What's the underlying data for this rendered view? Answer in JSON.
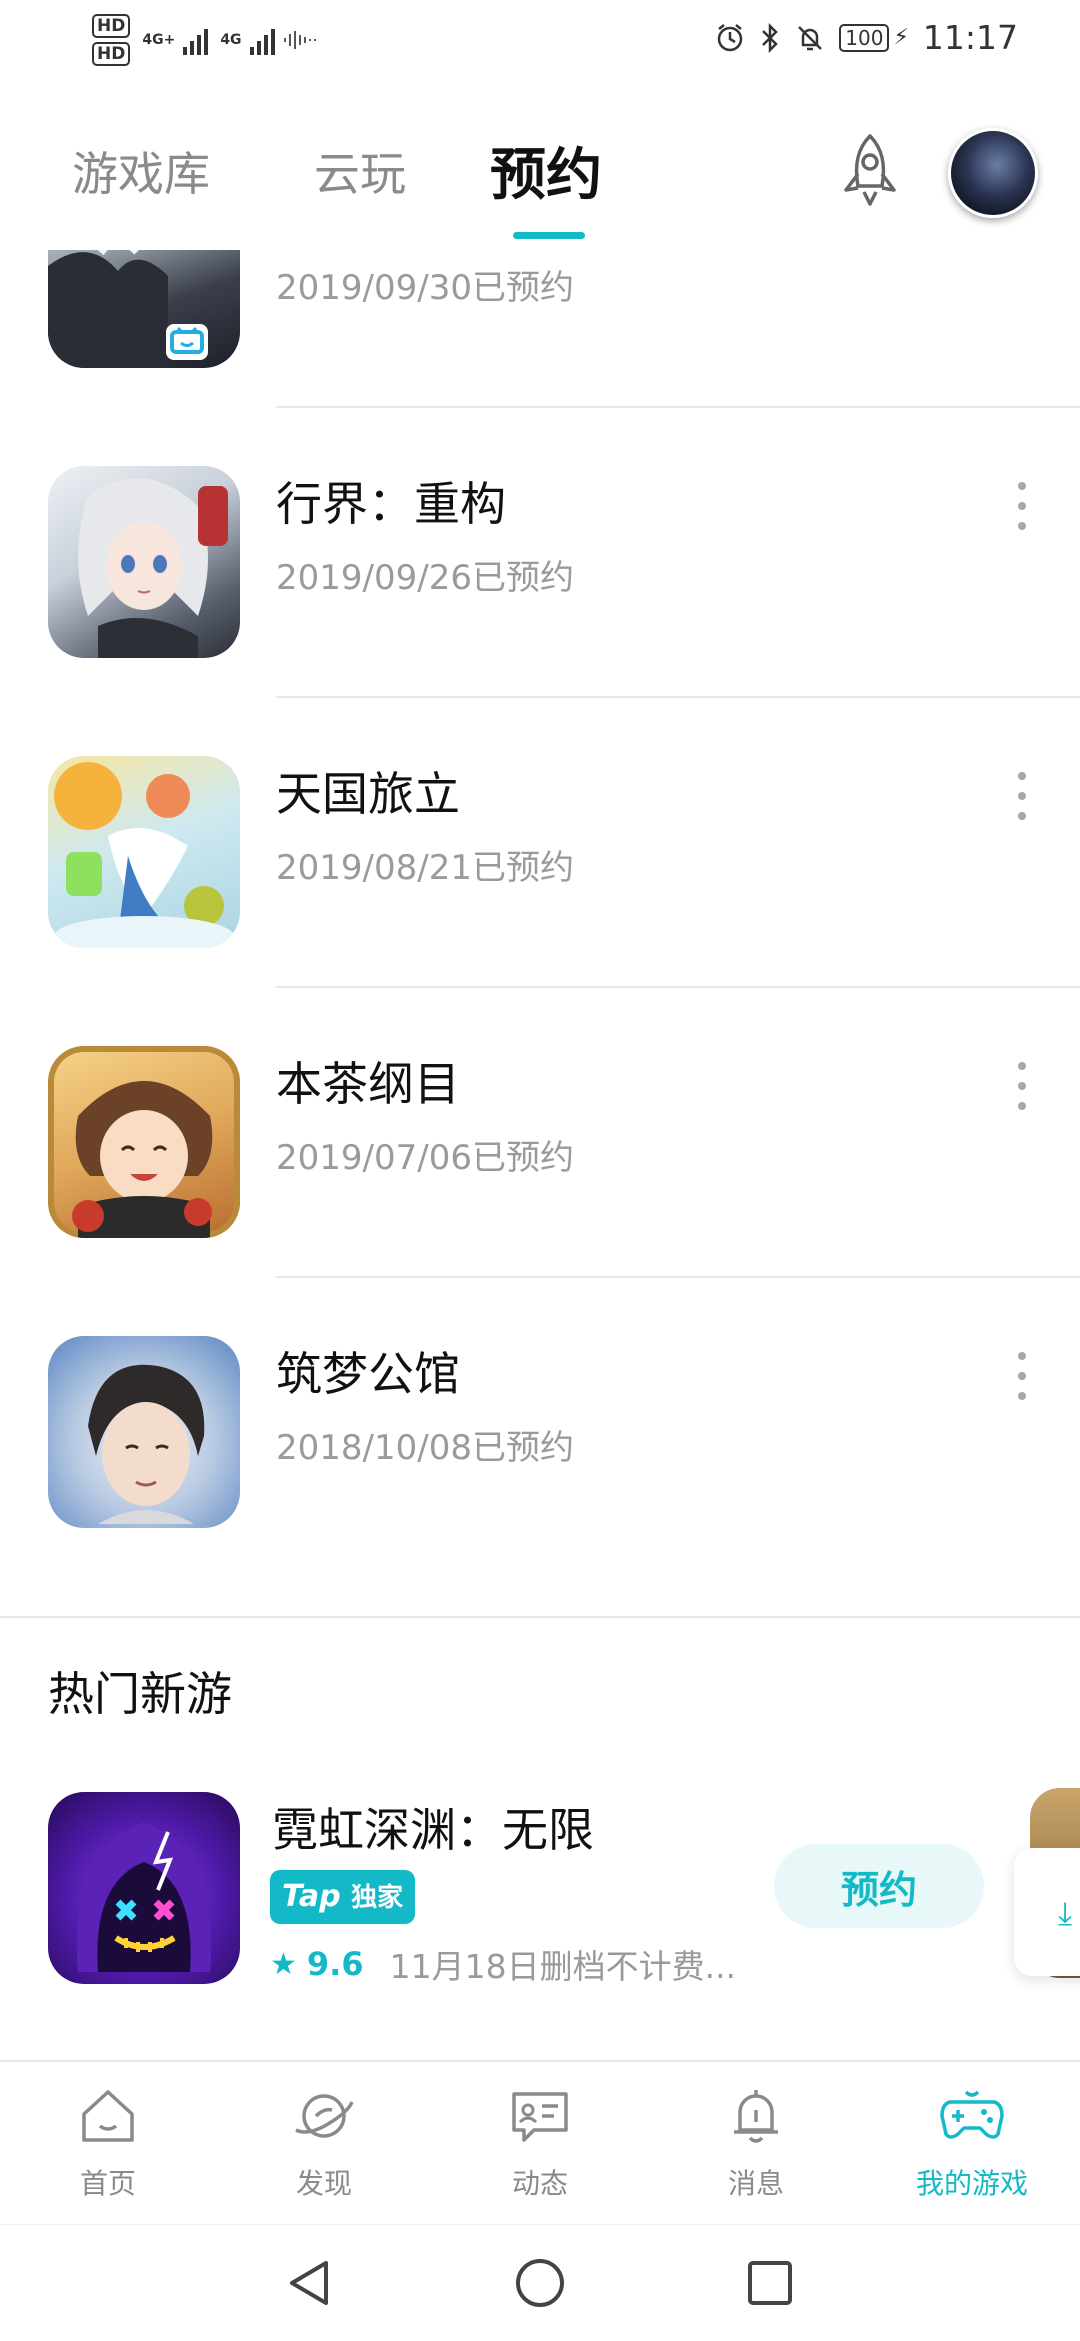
{
  "status_bar": {
    "sim1": "HD",
    "sim2": "HD",
    "net1": "4G+",
    "net2": "4G",
    "battery": "100",
    "time": "11:17"
  },
  "header": {
    "tabs": [
      {
        "label": "游戏库",
        "active": false
      },
      {
        "label": "云玩",
        "active": false
      },
      {
        "label": "预约",
        "active": true
      }
    ]
  },
  "reservations": [
    {
      "title": "",
      "date": "2019/09/30已预约",
      "icon": "anime-character-fur-collar"
    },
    {
      "title": "行界：重构",
      "date": "2019/09/26已预约",
      "icon": "silver-hair-girl"
    },
    {
      "title": "天国旅立",
      "date": "2019/08/21已预约",
      "icon": "sky-girl-illustration"
    },
    {
      "title": "本茶纲目",
      "date": "2019/07/06已预约",
      "icon": "smiling-brown-hair-boy"
    },
    {
      "title": "筑梦公馆",
      "date": "2018/10/08已预约",
      "icon": "dark-hair-man"
    }
  ],
  "hot_section": {
    "title": "热门新游",
    "games": [
      {
        "title": "霓虹深渊：无限",
        "badge_tap": "Tap",
        "badge_exclusive": "独家",
        "rating": "9.6",
        "desc": "11月18日删档不计费...",
        "button": "预约"
      }
    ]
  },
  "bottom_nav": {
    "items": [
      {
        "label": "首页",
        "icon": "home-icon",
        "active": false
      },
      {
        "label": "发现",
        "icon": "planet-icon",
        "active": false
      },
      {
        "label": "动态",
        "icon": "chat-card-icon",
        "active": false
      },
      {
        "label": "消息",
        "icon": "bell-icon",
        "active": false
      },
      {
        "label": "我的游戏",
        "icon": "gamepad-icon",
        "active": true
      }
    ]
  },
  "colors": {
    "accent": "#14b9c8",
    "text_primary": "#111111",
    "text_secondary": "#9a9a9a",
    "divider": "#e8e8e8"
  }
}
